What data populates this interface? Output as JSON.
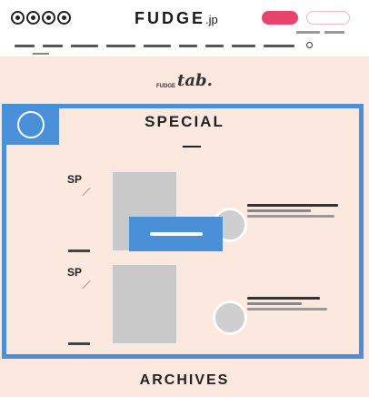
{
  "site": {
    "logo": "FUDGE",
    "logo_suffix": ".jp",
    "social_icons": [
      "social-icon-1",
      "social-icon-2",
      "social-icon-3",
      "social-icon-4"
    ]
  },
  "header": {
    "pink_button_color": "#e8426f",
    "outline_button_border": "#f4b6c6"
  },
  "section_logo": {
    "brand": "FUDGE",
    "script": "tab."
  },
  "special": {
    "title": "SPECIAL",
    "accent": "#4a90d9",
    "entries": [
      {
        "label": "SP"
      },
      {
        "label": "SP"
      }
    ]
  },
  "archives": {
    "title": "ARCHIVES"
  },
  "colors": {
    "page_background": "#fbe9df",
    "highlight": "#4a90d9"
  }
}
